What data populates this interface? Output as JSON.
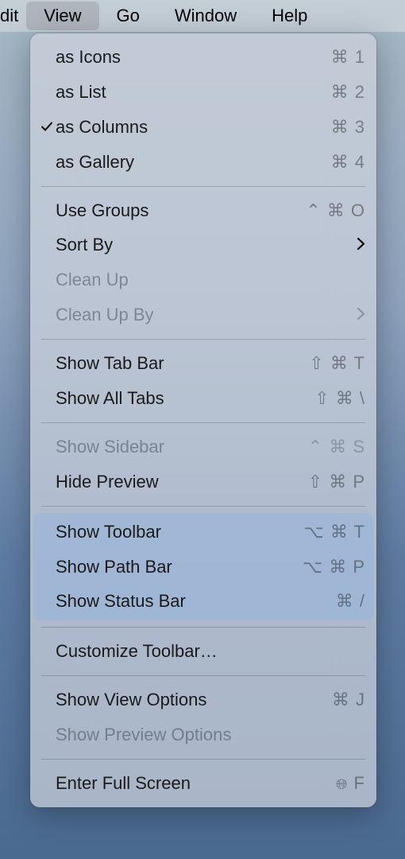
{
  "menubar": {
    "edit": "dit",
    "view": "View",
    "go": "Go",
    "window": "Window",
    "help": "Help"
  },
  "menu": {
    "as_icons": {
      "label": "as Icons",
      "accel": "⌘ 1"
    },
    "as_list": {
      "label": "as List",
      "accel": "⌘ 2"
    },
    "as_columns": {
      "label": "as Columns",
      "accel": "⌘ 3"
    },
    "as_gallery": {
      "label": "as Gallery",
      "accel": "⌘ 4"
    },
    "use_groups": {
      "label": "Use Groups",
      "accel": "⌃ ⌘ O"
    },
    "sort_by": {
      "label": "Sort By"
    },
    "clean_up": {
      "label": "Clean Up"
    },
    "clean_up_by": {
      "label": "Clean Up By"
    },
    "show_tab_bar": {
      "label": "Show Tab Bar",
      "accel": "⇧ ⌘ T"
    },
    "show_all_tabs": {
      "label": "Show All Tabs",
      "accel": "⇧ ⌘ \\"
    },
    "show_sidebar": {
      "label": "Show Sidebar",
      "accel": "⌃ ⌘ S"
    },
    "hide_preview": {
      "label": "Hide Preview",
      "accel": "⇧ ⌘ P"
    },
    "show_toolbar": {
      "label": "Show Toolbar",
      "accel": "⌥ ⌘ T"
    },
    "show_path_bar": {
      "label": "Show Path Bar",
      "accel": "⌥ ⌘ P"
    },
    "show_status_bar": {
      "label": "Show Status Bar",
      "accel": "⌘ /"
    },
    "customize_toolbar": {
      "label": "Customize Toolbar…"
    },
    "show_view_options": {
      "label": "Show View Options",
      "accel": "⌘ J"
    },
    "show_preview_options": {
      "label": "Show Preview Options"
    },
    "enter_full_screen": {
      "label": "Enter Full Screen",
      "accel": "🌐︎ F"
    }
  }
}
